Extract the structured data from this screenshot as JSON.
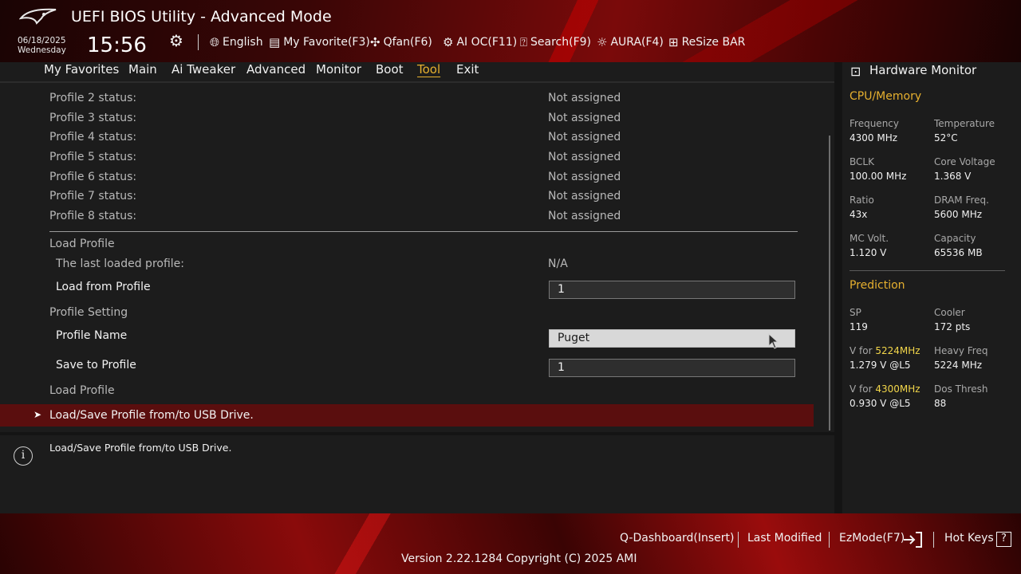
{
  "header": {
    "title": "UEFI BIOS Utility - Advanced Mode",
    "date": "06/18/2025",
    "weekday": "Wednesday",
    "time": "15:56",
    "toolbar": [
      {
        "icon": "globe-icon",
        "label": "English"
      },
      {
        "icon": "favorite-list-icon",
        "label": "My Favorite(F3)"
      },
      {
        "icon": "fan-icon",
        "label": "Qfan(F6)"
      },
      {
        "icon": "ai-chip-icon",
        "label": "AI OC(F11)"
      },
      {
        "icon": "search-help-icon",
        "label": "Search(F9)"
      },
      {
        "icon": "aura-light-icon",
        "label": "AURA(F4)"
      },
      {
        "icon": "resize-bar-icon",
        "label": "ReSize BAR"
      }
    ]
  },
  "tabs": [
    "My Favorites",
    "Main",
    "Ai Tweaker",
    "Advanced",
    "Monitor",
    "Boot",
    "Tool",
    "Exit"
  ],
  "active_tab": "Tool",
  "profiles": [
    {
      "label": "Profile 2 status:",
      "value": "Not assigned"
    },
    {
      "label": "Profile 3 status:",
      "value": "Not assigned"
    },
    {
      "label": "Profile 4 status:",
      "value": "Not assigned"
    },
    {
      "label": "Profile 5 status:",
      "value": "Not assigned"
    },
    {
      "label": "Profile 6 status:",
      "value": "Not assigned"
    },
    {
      "label": "Profile 7 status:",
      "value": "Not assigned"
    },
    {
      "label": "Profile 8 status:",
      "value": "Not assigned"
    }
  ],
  "load_profile_header": "Load Profile",
  "last_loaded": {
    "label": "The last loaded profile:",
    "value": "N/A"
  },
  "load_from_profile": {
    "label": "Load from Profile",
    "value": "1"
  },
  "profile_setting_header": "Profile Setting",
  "profile_name": {
    "label": "Profile Name",
    "value": "Puget"
  },
  "save_to_profile": {
    "label": "Save to Profile",
    "value": "1"
  },
  "load_profile_header2": "Load Profile",
  "usb_item": "Load/Save Profile from/to USB Drive.",
  "help_text": "Load/Save Profile from/to USB Drive.",
  "hw": {
    "title": "Hardware Monitor",
    "cpu_mem_title": "CPU/Memory",
    "cpu": [
      {
        "label": "Frequency",
        "value": "4300 MHz"
      },
      {
        "label": "Temperature",
        "value": "52°C"
      },
      {
        "label": "BCLK",
        "value": "100.00 MHz"
      },
      {
        "label": "Core Voltage",
        "value": "1.368 V"
      },
      {
        "label": "Ratio",
        "value": "43x"
      },
      {
        "label": "DRAM Freq.",
        "value": "5600 MHz"
      },
      {
        "label": "MC Volt.",
        "value": "1.120 V"
      },
      {
        "label": "Capacity",
        "value": "65536 MB"
      }
    ],
    "prediction_title": "Prediction",
    "prediction": {
      "sp_label": "SP",
      "sp_value": "119",
      "cooler_label": "Cooler",
      "cooler_value": "172 pts",
      "v1_prefix": "V for ",
      "v1_freq": "5224MHz",
      "v1_value": "1.279 V @L5",
      "heavy_label": "Heavy Freq",
      "heavy_value": "5224 MHz",
      "v2_prefix": "V for ",
      "v2_freq": "4300MHz",
      "v2_value": "0.930 V @L5",
      "dos_label": "Dos Thresh",
      "dos_value": "88"
    }
  },
  "footer": {
    "qdashboard": "Q-Dashboard(Insert)",
    "last_modified": "Last Modified",
    "ezmode": "EzMode(F7)",
    "hotkeys": "Hot Keys",
    "hotkeys_symbol": "?",
    "version": "Version 2.22.1284 Copyright (C) 2025 AMI"
  },
  "colors": {
    "accent": "#e6b02f",
    "selected_row": "#5a0e0e",
    "highlight_freq": "#f2d64a"
  }
}
